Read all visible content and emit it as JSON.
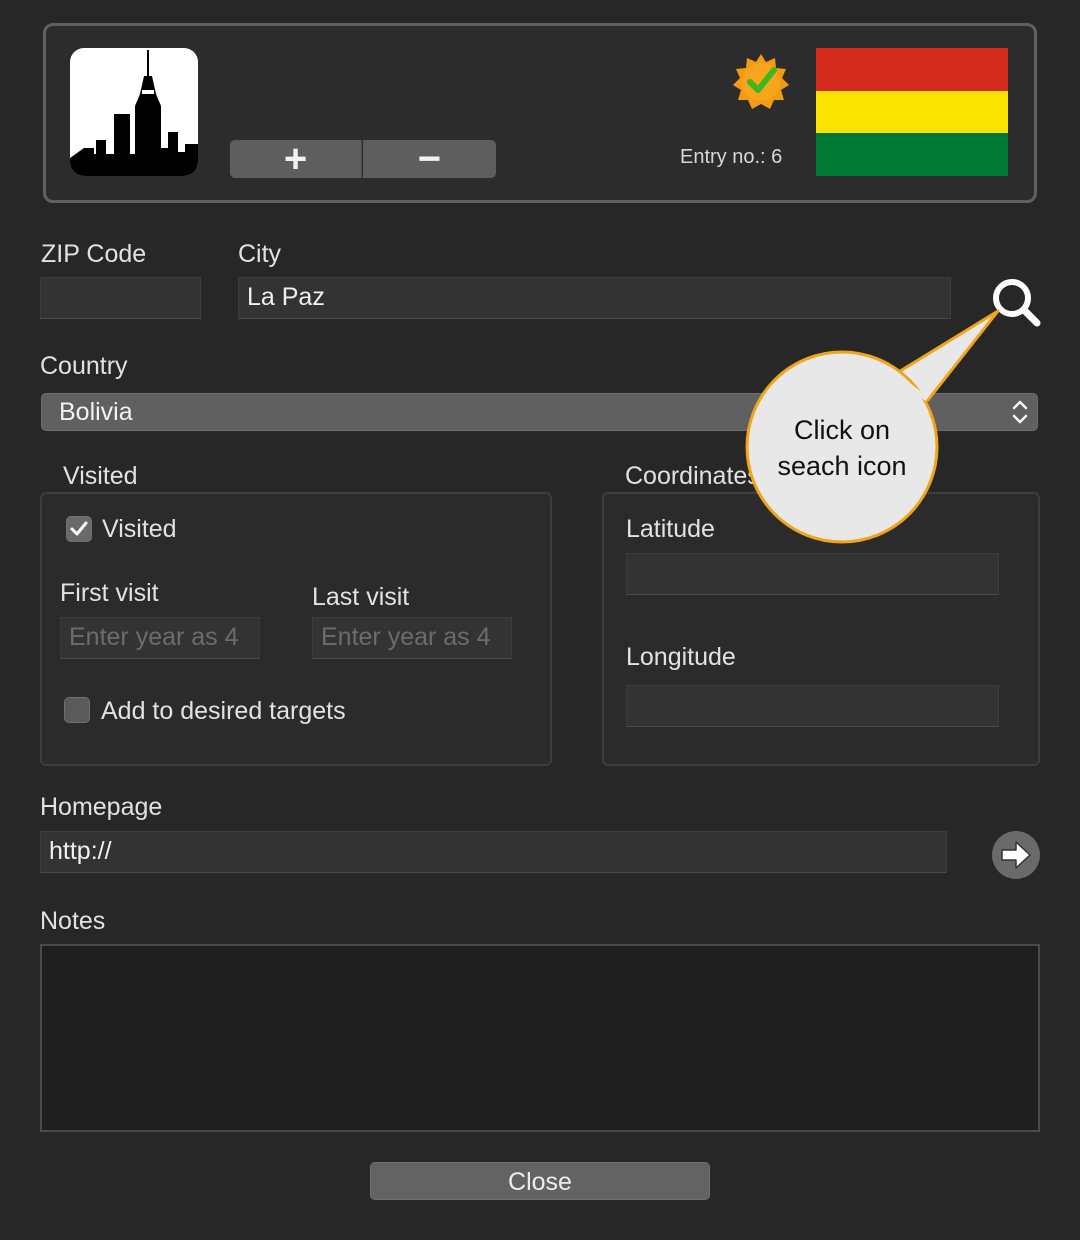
{
  "header": {
    "city_icon": "city-skyline-icon",
    "add_label": "+",
    "remove_label": "−",
    "badge_icon": "verified-badge-icon",
    "entry_label": "Entry no.: 6",
    "flag_colors": [
      "#d52b1e",
      "#f9e300",
      "#007934"
    ]
  },
  "zip": {
    "label": "ZIP Code",
    "value": ""
  },
  "city": {
    "label": "City",
    "value": "La Paz",
    "search_icon": "search-icon"
  },
  "callout": {
    "line1": "Click on",
    "line2": "seach icon"
  },
  "country": {
    "label": "Country",
    "value": "Bolivia"
  },
  "visited": {
    "title": "Visited",
    "checkbox_label": "Visited",
    "checked": true,
    "first_label": "First visit",
    "first_placeholder": "Enter year as 4",
    "last_label": "Last visit",
    "last_placeholder": "Enter year as 4",
    "target_label": "Add to desired targets"
  },
  "coordinates": {
    "title": "Coordinates",
    "lat_label": "Latitude",
    "lat_value": "",
    "lon_label": "Longitude",
    "lon_value": ""
  },
  "homepage": {
    "label": "Homepage",
    "value": "http://",
    "go_icon": "arrow-right-icon"
  },
  "notes": {
    "label": "Notes",
    "value": ""
  },
  "close_label": "Close"
}
